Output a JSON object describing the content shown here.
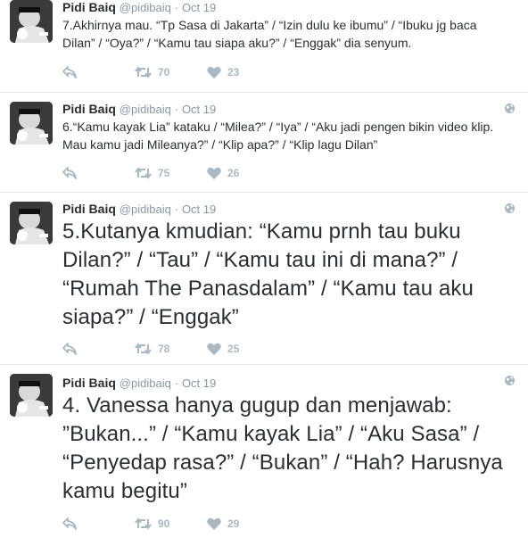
{
  "tweets": [
    {
      "name": "Pidi Baiq",
      "handle": "@pidibaiq",
      "separator": "·",
      "time": "Oct 19",
      "text": "7.Akhirnya mau. “Tp Sasa di Jakarta” / “Izin dulu ke ibumu” / “Ibuku jg baca Dilan” / “Oya?” / “Kamu tau siapa aku?” / “Enggak” dia senyum.",
      "retweets": "70",
      "likes": "23"
    },
    {
      "name": "Pidi Baiq",
      "handle": "@pidibaiq",
      "separator": "·",
      "time": "Oct 19",
      "text": "6.“Kamu kayak Lia” kataku / “Milea?” / “Iya” / “Aku jadi pengen bikin video klip. Mau kamu jadi Mileanya?” / “Klip apa?” / “Klip lagu Dilan”",
      "retweets": "75",
      "likes": "26"
    },
    {
      "name": "Pidi Baiq",
      "handle": "@pidibaiq",
      "separator": "·",
      "time": "Oct 19",
      "text": "5.Kutanya kmudian: “Kamu prnh tau buku Dilan?” / “Tau” / “Kamu tau ini di mana?” / “Rumah The Panasdalam” / “Kamu tau aku siapa?” / “Enggak”",
      "retweets": "78",
      "likes": "25"
    },
    {
      "name": "Pidi Baiq",
      "handle": "@pidibaiq",
      "separator": "·",
      "time": "Oct 19",
      "text": "4. Vanessa hanya gugup dan menjawab: ”Bukan...” / “Kamu kayak Lia” / “Aku Sasa” / “Penyedap rasa?” / “Bukan” / “Hah? Harusnya kamu begitu”",
      "retweets": "90",
      "likes": "29"
    }
  ],
  "icons": {
    "reply": "reply-icon",
    "retweet": "retweet-icon",
    "like": "heart-icon",
    "globe": "globe-icon",
    "avatar": "avatar-photo"
  },
  "colors": {
    "action_icon": "#aab8c2",
    "name": "#292f33",
    "meta": "#8899a6",
    "divider": "#e1e8ed"
  }
}
